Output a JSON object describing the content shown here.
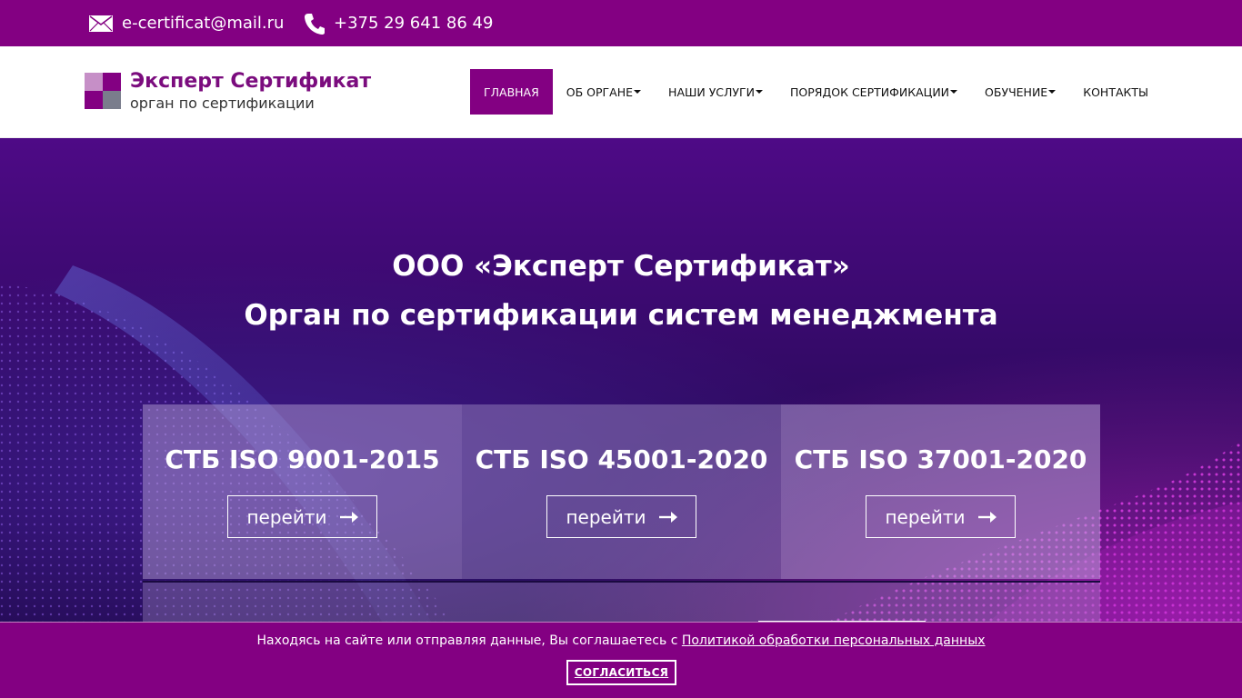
{
  "topbar": {
    "email": "e-certificat@mail.ru",
    "phone": "+375 29 641 86 49",
    "email_icon": "envelope-icon",
    "phone_icon": "phone-icon",
    "bg_color": "#830082"
  },
  "logo": {
    "title": "Эксперт Сертификат",
    "subtitle": "орган по сертификации",
    "colors": [
      "#c68fc7",
      "#830082",
      "#830082",
      "#7a7d8c"
    ]
  },
  "nav": {
    "items": [
      {
        "label": "ГЛАВНАЯ",
        "active": true,
        "dropdown": false
      },
      {
        "label": "ОБ ОРГАНЕ",
        "active": false,
        "dropdown": true
      },
      {
        "label": "НАШИ УСЛУГИ",
        "active": false,
        "dropdown": true
      },
      {
        "label": "ПОРЯДОК СЕРТИФИКАЦИИ",
        "active": false,
        "dropdown": true
      },
      {
        "label": "ОБУЧЕНИЕ",
        "active": false,
        "dropdown": true
      },
      {
        "label": "КОНТАКТЫ",
        "active": false,
        "dropdown": false
      }
    ]
  },
  "hero": {
    "title_line1": "ООО «Эксперт Сертификат»",
    "title_line2": "Орган по сертификации систем менеджмента"
  },
  "cards": [
    {
      "title": "СТБ ISO 9001-2015",
      "button_label": "перейти",
      "button_icon": "arrow-right-icon"
    },
    {
      "title": "СТБ ISO 45001-2020",
      "button_label": "перейти",
      "button_icon": "arrow-right-icon"
    },
    {
      "title": "СТБ ISO 37001-2020",
      "button_label": "перейти",
      "button_icon": "arrow-right-icon"
    }
  ],
  "cookie": {
    "text": "Находясь на сайте или отправляя данные, Вы соглашаетесь с ",
    "link_text": "Политикой обработки персональных данных",
    "button_label": "СОГЛАСИТЬСЯ"
  }
}
